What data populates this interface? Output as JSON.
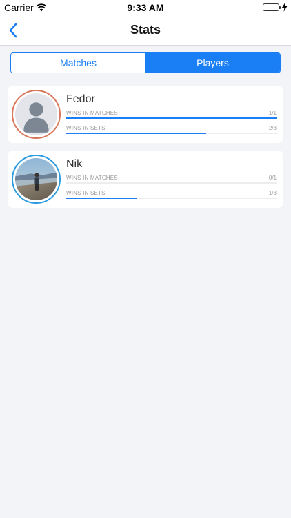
{
  "status_bar": {
    "carrier": "Carrier",
    "time": "9:33 AM",
    "wifi_icon": "wifi-icon",
    "battery_icon": "battery-icon",
    "battery_level": 1.0
  },
  "nav": {
    "back_icon": "chevron-left-icon",
    "title": "Stats"
  },
  "segmented": {
    "items": [
      {
        "label": "Matches",
        "selected": false
      },
      {
        "label": "Players",
        "selected": true
      }
    ]
  },
  "players": [
    {
      "name": "Fedor",
      "ring_color": "#d9775a",
      "avatar": "avatar-placeholder",
      "stats": [
        {
          "label": "WINS IN MATCHES",
          "value": "1/1",
          "fraction": 1.0
        },
        {
          "label": "WINS IN SETS",
          "value": "2/3",
          "fraction": 0.667
        }
      ]
    },
    {
      "name": "Nik",
      "ring_color": "#2b9be0",
      "avatar": "avatar-photo",
      "stats": [
        {
          "label": "WINS IN MATCHES",
          "value": "0/1",
          "fraction": 0.0
        },
        {
          "label": "WINS IN SETS",
          "value": "1/3",
          "fraction": 0.333
        }
      ]
    }
  ],
  "colors": {
    "accent": "#1a7ff5",
    "background": "#f3f4f8"
  }
}
